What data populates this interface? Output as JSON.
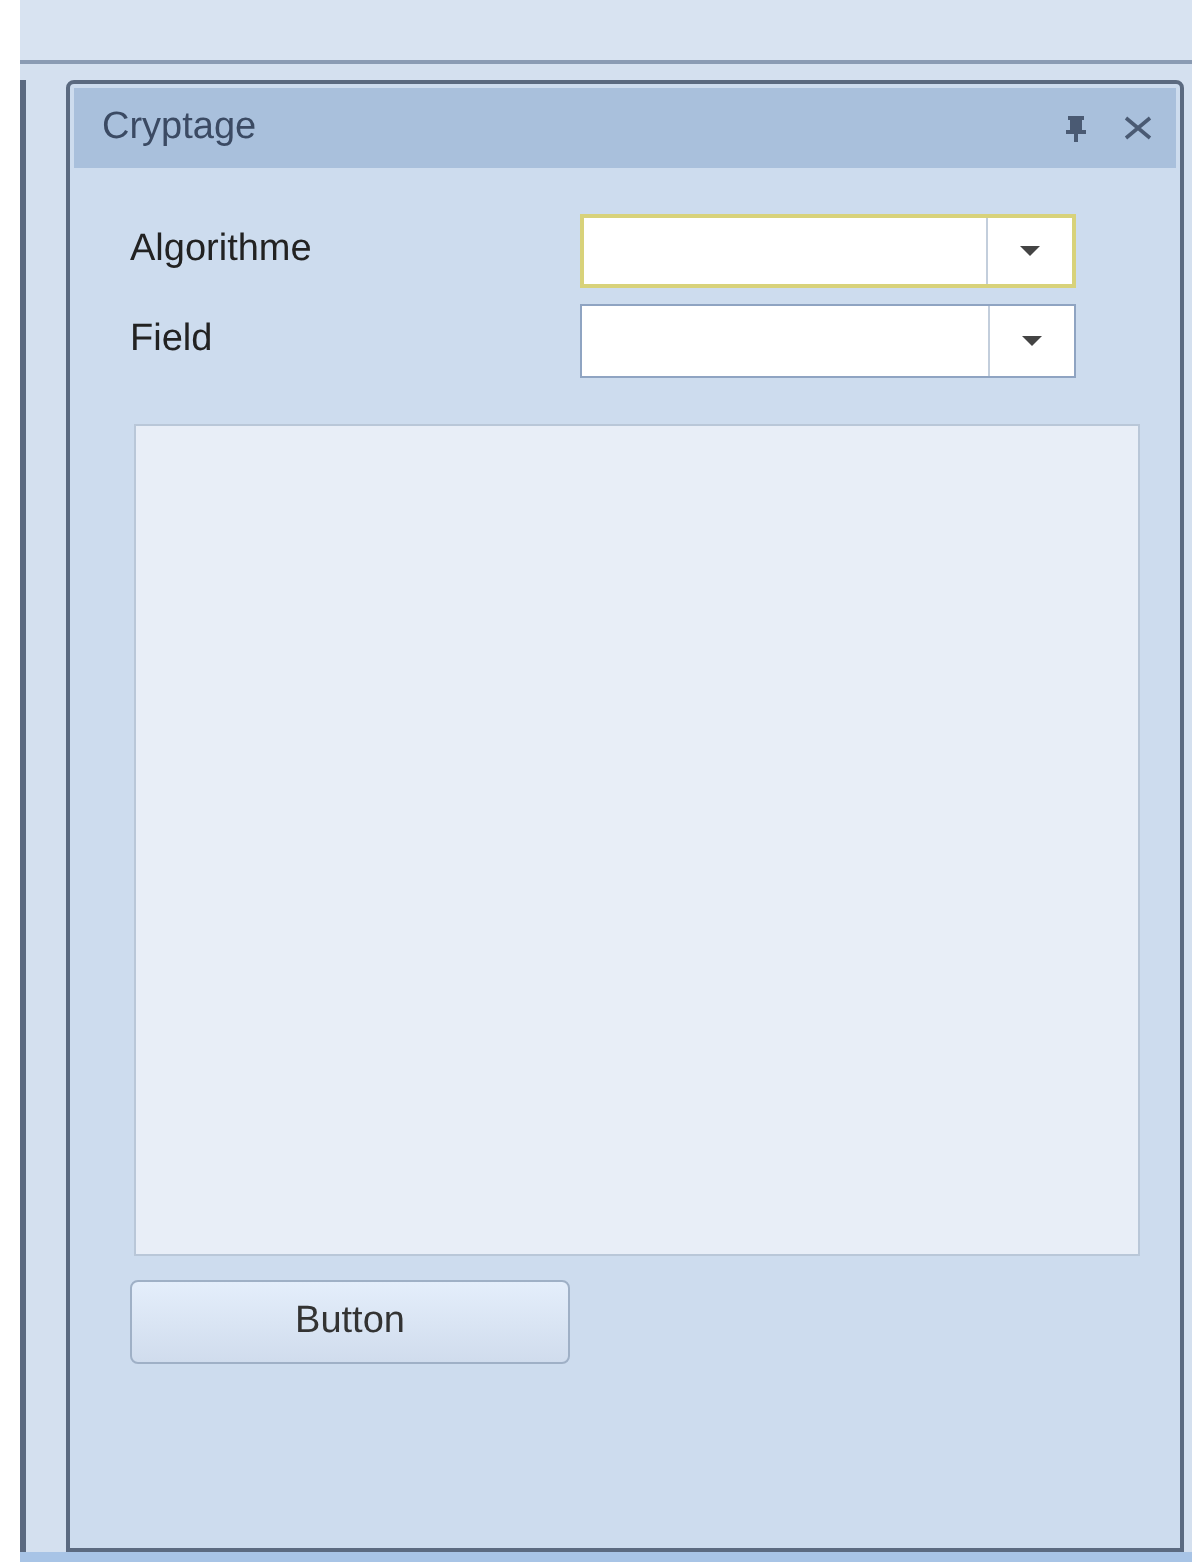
{
  "panel": {
    "title": "Cryptage"
  },
  "fields": [
    {
      "label": "Algorithme",
      "focused": true
    },
    {
      "label": "Field",
      "focused": false
    }
  ],
  "button": {
    "label": "Button"
  }
}
